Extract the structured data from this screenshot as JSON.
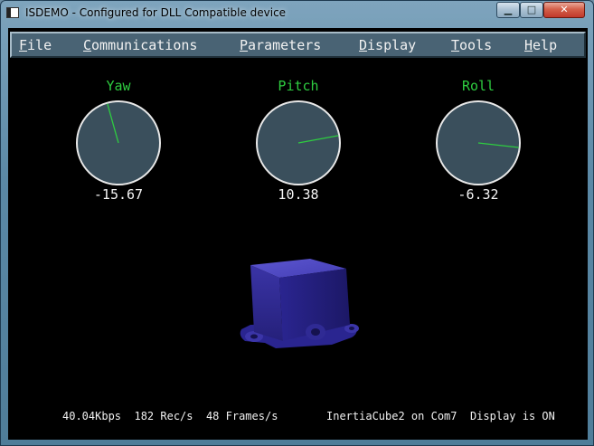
{
  "window": {
    "title": "ISDEMO - Configured for DLL Compatible device",
    "controls": {
      "minimize": "▁",
      "maximize": "□",
      "close": "✕"
    }
  },
  "menu": {
    "items": [
      {
        "label": "File"
      },
      {
        "label": "Communications"
      },
      {
        "label": "Parameters"
      },
      {
        "label": "Display"
      },
      {
        "label": "Tools"
      },
      {
        "label": "Help"
      }
    ]
  },
  "gauges": [
    {
      "label": "Yaw",
      "value": "-15.67",
      "angle_deg": -15.67
    },
    {
      "label": "Pitch",
      "value": "10.38",
      "angle_deg": 10.38
    },
    {
      "label": "Roll",
      "value": "-6.32",
      "angle_deg": -6.32
    }
  ],
  "status": {
    "left": "40.04Kbps  182 Rec/s  48 Frames/s",
    "right": "InertiaCube2 on Com7  Display is ON"
  },
  "colors": {
    "gauge_fill": "#3a4f5c",
    "needle": "#2ecc40",
    "label_green": "#2ecc40",
    "cube": "#2f2a8c",
    "menubar": "#496374"
  }
}
